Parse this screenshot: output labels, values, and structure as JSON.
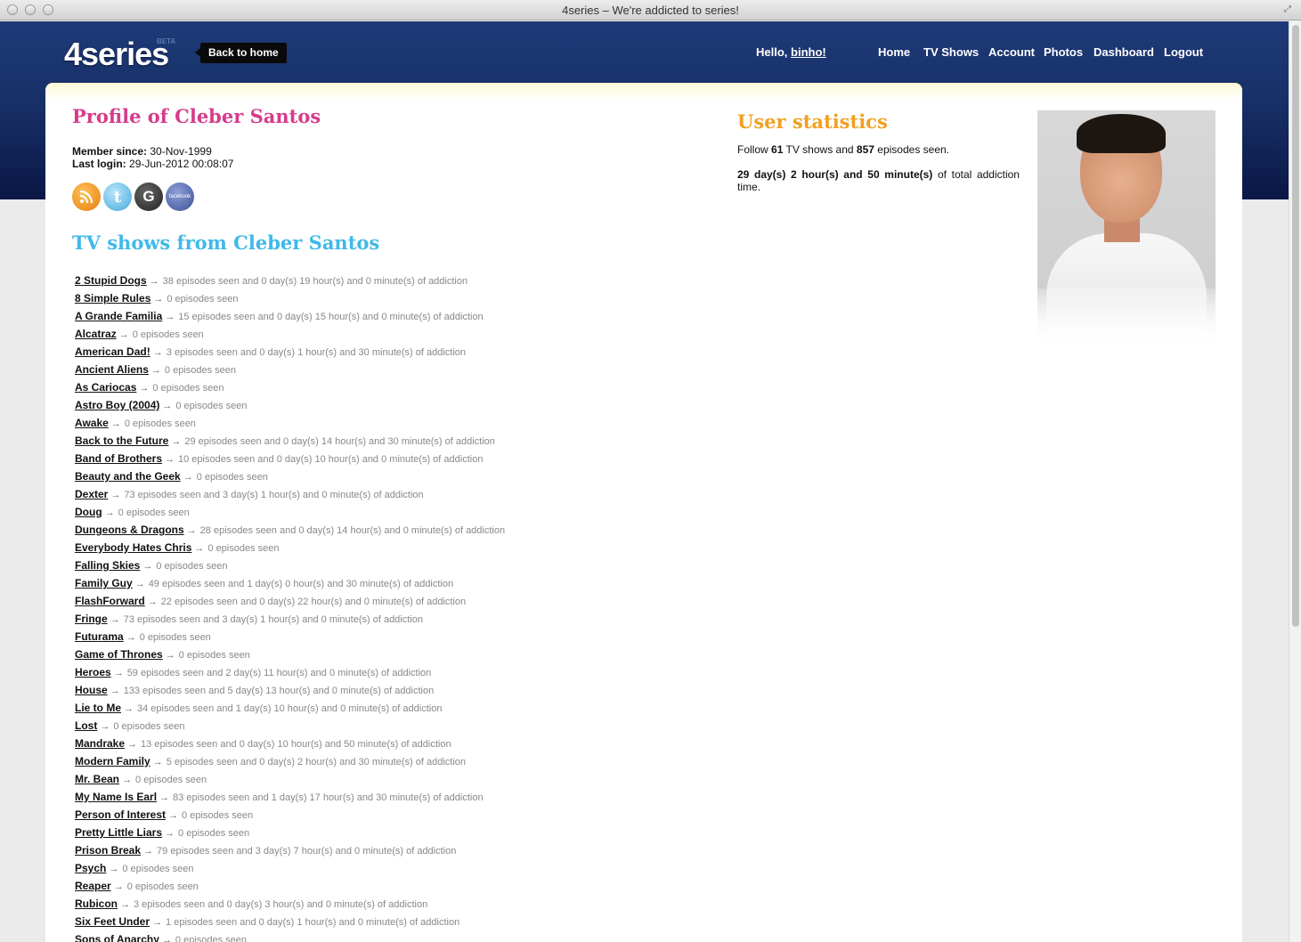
{
  "window": {
    "title": "4series – We're addicted to series!"
  },
  "header": {
    "logo": "4series",
    "beta": "BETA",
    "back_home": "Back to home",
    "hello_prefix": "Hello,",
    "username": "binho!",
    "nav": [
      "Home",
      "TV Shows",
      "Account",
      "Photos",
      "Dashboard",
      "Logout"
    ]
  },
  "profile": {
    "title": "Profile of Cleber Santos",
    "member_since_label": "Member since:",
    "member_since": "30-Nov-1999",
    "last_login_label": "Last login:",
    "last_login": "29-Jun-2012 00:08:07",
    "social_icons": [
      "rss-icon",
      "twitter-icon",
      "google-icon",
      "facebook-icon"
    ],
    "twitter_glyph": "t",
    "google_glyph": "G",
    "facebook_glyph": "facebook"
  },
  "shows_section": {
    "title": "TV shows from Cleber Santos",
    "arrow": "→"
  },
  "shows": [
    {
      "name": "2 Stupid Dogs",
      "detail": "38 episodes seen and 0 day(s) 19 hour(s) and 0 minute(s) of addiction"
    },
    {
      "name": "8 Simple Rules",
      "detail": "0 episodes seen"
    },
    {
      "name": "A Grande Familia",
      "detail": "15 episodes seen and 0 day(s) 15 hour(s) and 0 minute(s) of addiction"
    },
    {
      "name": "Alcatraz",
      "detail": "0 episodes seen"
    },
    {
      "name": "American Dad!",
      "detail": "3 episodes seen and 0 day(s) 1 hour(s) and 30 minute(s) of addiction"
    },
    {
      "name": "Ancient Aliens",
      "detail": "0 episodes seen"
    },
    {
      "name": "As Cariocas",
      "detail": "0 episodes seen"
    },
    {
      "name": "Astro Boy (2004)",
      "detail": "0 episodes seen"
    },
    {
      "name": "Awake",
      "detail": "0 episodes seen"
    },
    {
      "name": "Back to the Future",
      "detail": "29 episodes seen and 0 day(s) 14 hour(s) and 30 minute(s) of addiction"
    },
    {
      "name": "Band of Brothers",
      "detail": "10 episodes seen and 0 day(s) 10 hour(s) and 0 minute(s) of addiction"
    },
    {
      "name": "Beauty and the Geek",
      "detail": "0 episodes seen"
    },
    {
      "name": "Dexter",
      "detail": "73 episodes seen and 3 day(s) 1 hour(s) and 0 minute(s) of addiction"
    },
    {
      "name": "Doug",
      "detail": "0 episodes seen"
    },
    {
      "name": "Dungeons & Dragons",
      "detail": "28 episodes seen and 0 day(s) 14 hour(s) and 0 minute(s) of addiction"
    },
    {
      "name": "Everybody Hates Chris",
      "detail": "0 episodes seen"
    },
    {
      "name": "Falling Skies",
      "detail": "0 episodes seen"
    },
    {
      "name": "Family Guy",
      "detail": "49 episodes seen and 1 day(s) 0 hour(s) and 30 minute(s) of addiction"
    },
    {
      "name": "FlashForward",
      "detail": "22 episodes seen and 0 day(s) 22 hour(s) and 0 minute(s) of addiction"
    },
    {
      "name": "Fringe",
      "detail": "73 episodes seen and 3 day(s) 1 hour(s) and 0 minute(s) of addiction"
    },
    {
      "name": "Futurama",
      "detail": "0 episodes seen"
    },
    {
      "name": "Game of Thrones",
      "detail": "0 episodes seen"
    },
    {
      "name": "Heroes",
      "detail": "59 episodes seen and 2 day(s) 11 hour(s) and 0 minute(s) of addiction"
    },
    {
      "name": "House",
      "detail": "133 episodes seen and 5 day(s) 13 hour(s) and 0 minute(s) of addiction"
    },
    {
      "name": "Lie to Me",
      "detail": "34 episodes seen and 1 day(s) 10 hour(s) and 0 minute(s) of addiction"
    },
    {
      "name": "Lost",
      "detail": "0 episodes seen"
    },
    {
      "name": "Mandrake",
      "detail": "13 episodes seen and 0 day(s) 10 hour(s) and 50 minute(s) of addiction"
    },
    {
      "name": "Modern Family",
      "detail": "5 episodes seen and 0 day(s) 2 hour(s) and 30 minute(s) of addiction"
    },
    {
      "name": "Mr. Bean",
      "detail": "0 episodes seen"
    },
    {
      "name": "My Name Is Earl",
      "detail": "83 episodes seen and 1 day(s) 17 hour(s) and 30 minute(s) of addiction"
    },
    {
      "name": "Person of Interest",
      "detail": "0 episodes seen"
    },
    {
      "name": "Pretty Little Liars",
      "detail": "0 episodes seen"
    },
    {
      "name": "Prison Break",
      "detail": "79 episodes seen and 3 day(s) 7 hour(s) and 0 minute(s) of addiction"
    },
    {
      "name": "Psych",
      "detail": "0 episodes seen"
    },
    {
      "name": "Reaper",
      "detail": "0 episodes seen"
    },
    {
      "name": "Rubicon",
      "detail": "3 episodes seen and 0 day(s) 3 hour(s) and 0 minute(s) of addiction"
    },
    {
      "name": "Six Feet Under",
      "detail": "1 episodes seen and 0 day(s) 1 hour(s) and 0 minute(s) of addiction"
    },
    {
      "name": "Sons of Anarchy",
      "detail": "0 episodes seen"
    }
  ],
  "stats": {
    "title": "User statistics",
    "follow_prefix": "Follow",
    "shows_count": "61",
    "follow_middle": "TV shows and",
    "episodes_count": "857",
    "follow_suffix": "episodes seen.",
    "addiction_time": "29 day(s) 2 hour(s) and 50 minute(s)",
    "addiction_suffix": "of total addiction time."
  },
  "colors": {
    "profile_title": "#d63c8b",
    "shows_title": "#3fb9e8",
    "stats_title": "#f0a020",
    "header_blue": "#173067"
  }
}
